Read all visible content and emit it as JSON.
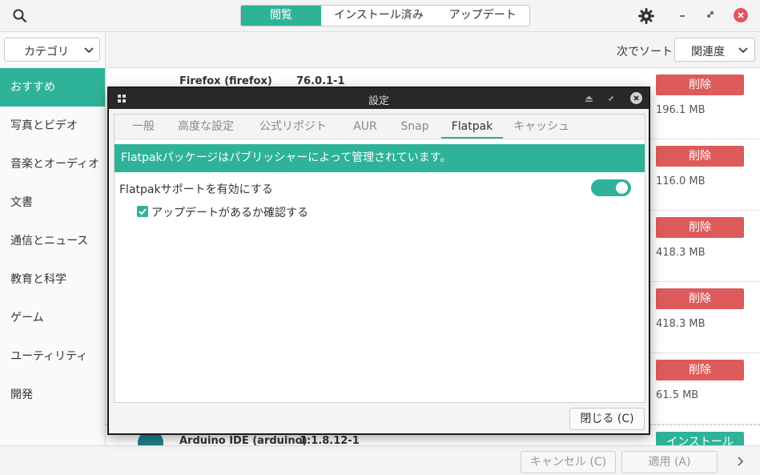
{
  "header": {
    "tabs": [
      {
        "label": "閲覧",
        "active": true
      },
      {
        "label": "インストール済み",
        "active": false
      },
      {
        "label": "アップデート",
        "active": false
      }
    ],
    "icons": {
      "search": "search-icon",
      "settings": "gear-icon",
      "minimize": "minimize-icon",
      "maximize": "maximize-icon",
      "close": "close-icon"
    }
  },
  "sidebar": {
    "category_select": "カテゴリ",
    "items": [
      {
        "label": "おすすめ",
        "active": true
      },
      {
        "label": "写真とビデオ",
        "active": false
      },
      {
        "label": "音楽とオーディオ",
        "active": false
      },
      {
        "label": "文書",
        "active": false
      },
      {
        "label": "通信とニュース",
        "active": false
      },
      {
        "label": "教育と科学",
        "active": false
      },
      {
        "label": "ゲーム",
        "active": false
      },
      {
        "label": "ユーティリティ",
        "active": false
      },
      {
        "label": "開発",
        "active": false
      }
    ]
  },
  "main": {
    "sort_label": "次でソート",
    "sort_value": "関連度",
    "rows": [
      {
        "title": "Firefox (firefox)",
        "version": "76.0.1-1",
        "action": "削除",
        "size": "196.1 MB"
      },
      {
        "title": "",
        "version": "",
        "action": "削除",
        "size": "116.0 MB"
      },
      {
        "title": "",
        "version": "",
        "action": "削除",
        "size": "418.3 MB"
      },
      {
        "title": "",
        "version": "",
        "action": "削除",
        "size": "418.3 MB"
      },
      {
        "title": "",
        "version": "",
        "action": "削除",
        "size": "61.5 MB"
      }
    ],
    "last_row": {
      "title": "Arduino IDE (arduino)",
      "version": "1:1.8.12-1",
      "action": "インストール"
    }
  },
  "bottom": {
    "cancel": "キャンセル (C)",
    "apply": "適用 (A)"
  },
  "dialog": {
    "title": "設定",
    "tabs": [
      {
        "label": "一般",
        "active": false
      },
      {
        "label": "高度な設定",
        "active": false
      },
      {
        "label": "公式リポジトリ",
        "active": false
      },
      {
        "label": "AUR",
        "active": false
      },
      {
        "label": "Snap",
        "active": false
      },
      {
        "label": "Flatpak",
        "active": true
      },
      {
        "label": "キャッシュ",
        "active": false
      }
    ],
    "banner": "Flatpakパッケージはパブリッシャーによって管理されています。",
    "enable_label": "Flatpakサポートを有効にする",
    "enable_on": true,
    "check_updates_label": "アップデートがあるか確認する",
    "check_updates_checked": true,
    "close_button": "閉じる (C)"
  },
  "colors": {
    "accent": "#2eb398",
    "danger": "#dd5b5b"
  }
}
